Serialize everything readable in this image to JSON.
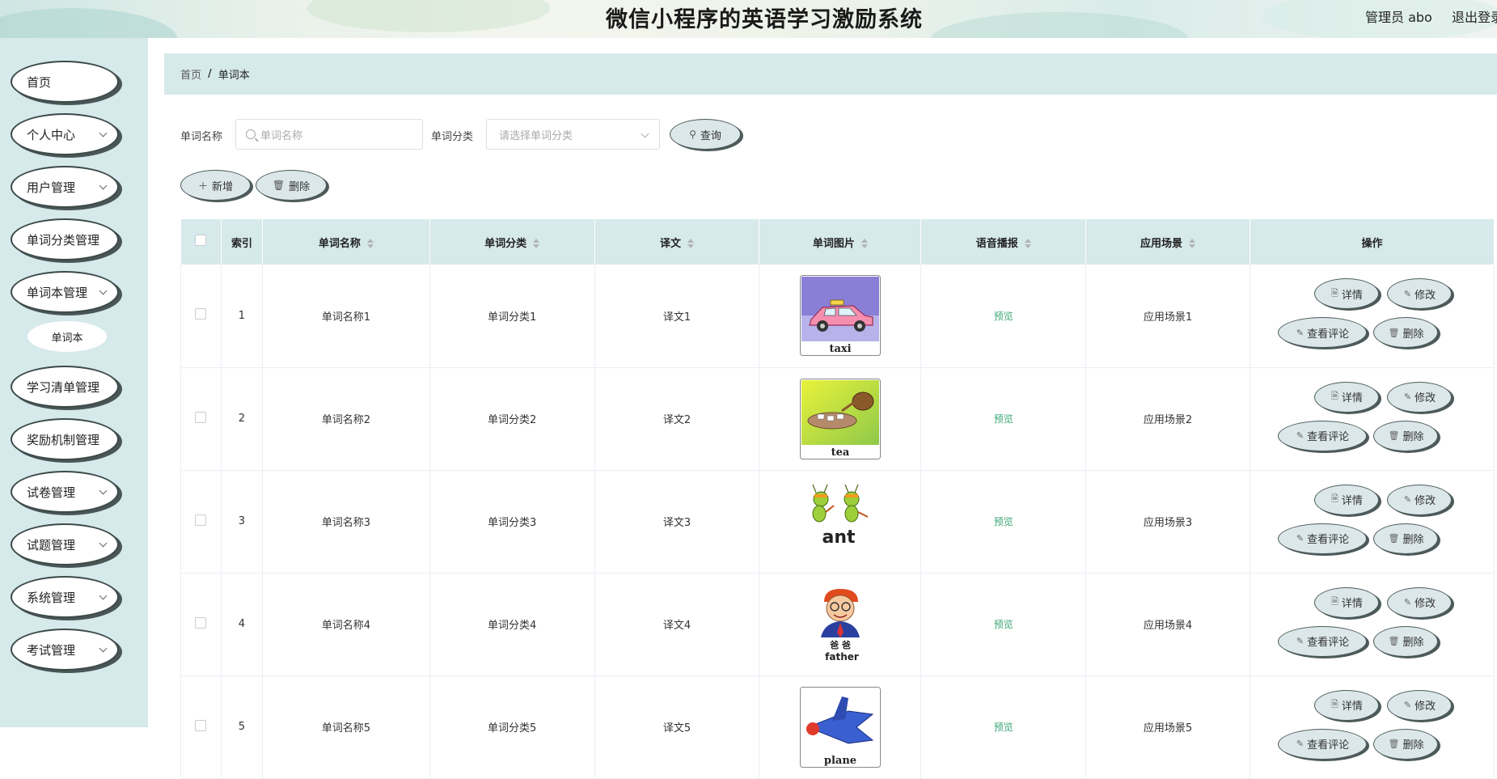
{
  "header": {
    "title": "微信小程序的英语学习激励系统",
    "user": "管理员 abo",
    "logout": "退出登录"
  },
  "sidebar": {
    "items": [
      {
        "label": "首页",
        "chevron": false
      },
      {
        "label": "个人中心",
        "chevron": true
      },
      {
        "label": "用户管理",
        "chevron": true
      },
      {
        "label": "单词分类管理",
        "chevron": false
      },
      {
        "label": "单词本管理",
        "chevron": true
      },
      {
        "label": "学习清单管理",
        "chevron": false
      },
      {
        "label": "奖励机制管理",
        "chevron": false
      },
      {
        "label": "试卷管理",
        "chevron": true
      },
      {
        "label": "试题管理",
        "chevron": true
      },
      {
        "label": "系统管理",
        "chevron": true
      },
      {
        "label": "考试管理",
        "chevron": true
      }
    ],
    "sub_item": "单词本"
  },
  "breadcrumb": {
    "home": "首页",
    "separator": "/",
    "current": "单词本"
  },
  "search": {
    "name_label": "单词名称",
    "name_placeholder": "单词名称",
    "category_label": "单词分类",
    "category_placeholder": "请选择单词分类",
    "query_button": "查询"
  },
  "actions": {
    "add": "新增",
    "delete": "删除"
  },
  "table": {
    "headers": [
      "索引",
      "单词名称",
      "单词分类",
      "译文",
      "单词图片",
      "语音播报",
      "应用场景",
      "操作"
    ],
    "rows": [
      {
        "index": "1",
        "name": "单词名称1",
        "category": "单词分类1",
        "translation": "译文1",
        "image": "taxi",
        "audio": "预览",
        "scene": "应用场景1"
      },
      {
        "index": "2",
        "name": "单词名称2",
        "category": "单词分类2",
        "translation": "译文2",
        "image": "tea",
        "audio": "预览",
        "scene": "应用场景2"
      },
      {
        "index": "3",
        "name": "单词名称3",
        "category": "单词分类3",
        "translation": "译文3",
        "image": "ant",
        "audio": "预览",
        "scene": "应用场景3"
      },
      {
        "index": "4",
        "name": "单词名称4",
        "category": "单词分类4",
        "translation": "译文4",
        "image": "father",
        "image_caption": "爸 爸",
        "audio": "预览",
        "scene": "应用场景4"
      },
      {
        "index": "5",
        "name": "单词名称5",
        "category": "单词分类5",
        "translation": "译文5",
        "image": "plane",
        "audio": "预览",
        "scene": "应用场景5"
      }
    ],
    "ops": {
      "detail": "详情",
      "edit": "修改",
      "comments": "查看评论",
      "delete": "删除"
    }
  },
  "colors": {
    "sidebar_bg": "#d6e9eb",
    "pill_bg": "#dbe7e8",
    "preview_link": "#3aa675"
  }
}
